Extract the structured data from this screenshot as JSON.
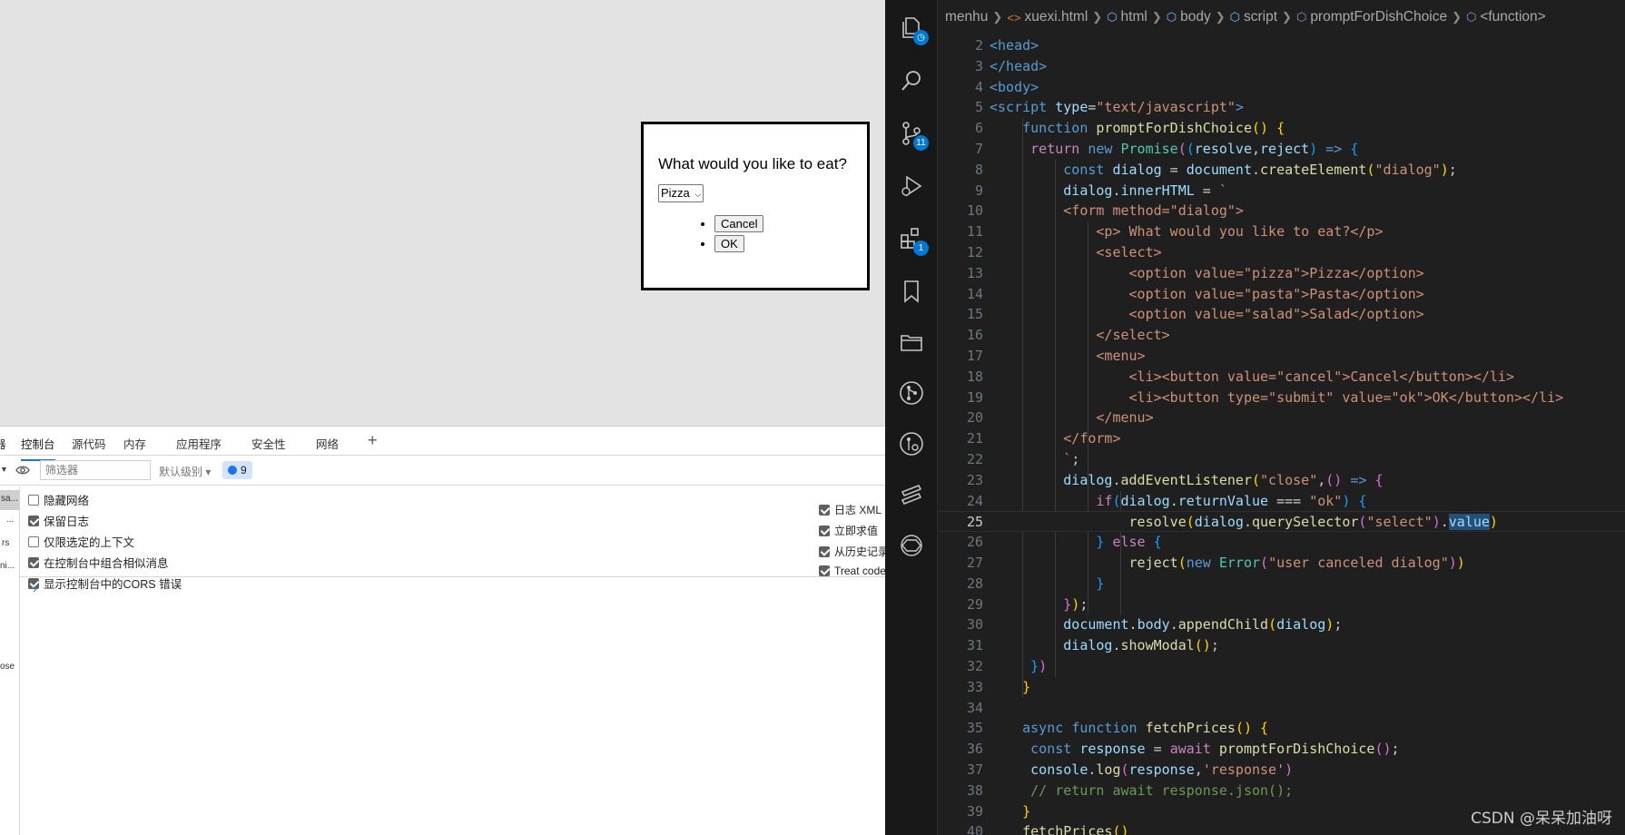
{
  "browser": {
    "dialog": {
      "question": "What would you like to eat?",
      "select_value": "Pizza",
      "cancel_label": "Cancel",
      "ok_label": "OK"
    }
  },
  "devtools": {
    "tabs": [
      "器",
      "控制台",
      "源代码",
      "内存",
      "应用程序",
      "安全性",
      "网络",
      "+"
    ],
    "active_tab": "控制台",
    "filter_placeholder": "筛选器",
    "level_label": "默认级别 ▾",
    "message_count": "9",
    "left_strip": [
      "sa...",
      "...",
      "rs",
      "ni...",
      "ose"
    ],
    "settings_left": [
      {
        "label": "隐藏网络",
        "checked": false
      },
      {
        "label": "保留日志",
        "checked": true
      },
      {
        "label": "仅限选定的上下文",
        "checked": false
      },
      {
        "label": "在控制台中组合相似消息",
        "checked": true
      },
      {
        "label": "显示控制台中的CORS 错误",
        "checked": true
      }
    ],
    "settings_right": [
      {
        "label": "日志 XML",
        "checked": true
      },
      {
        "label": "立即求值",
        "checked": true
      },
      {
        "label": "从历史记录",
        "checked": true
      },
      {
        "label": "Treat code",
        "checked": true
      }
    ],
    "prompt": "›"
  },
  "vscode": {
    "activity_badges": {
      "source_control": "11",
      "extensions": "1"
    },
    "breadcrumb": [
      "menhu",
      "xuexi.html",
      "html",
      "body",
      "script",
      "promptForDishChoice",
      "<function>"
    ],
    "current_line": 25,
    "lines": [
      {
        "n": "2",
        "html": "<span class='tk-tag'>&lt;head&gt;</span>"
      },
      {
        "n": "3",
        "html": "<span class='tk-tag'>&lt;/head&gt;</span>"
      },
      {
        "n": "4",
        "html": "<span class='tk-tag'>&lt;body&gt;</span>"
      },
      {
        "n": "5",
        "html": "<span class='tk-tag'>&lt;script</span> <span class='tk-attr'>type</span>=<span class='tk-str'>\"text/javascript\"</span><span class='tk-tag'>&gt;</span>"
      },
      {
        "n": "6",
        "html": "    <span class='tk-kw'>function</span> <span class='tk-fn'>promptForDishChoice</span><span class='tk-b1'>()</span> <span class='tk-b1'>{</span>"
      },
      {
        "n": "7",
        "html": "     <span class='tk-ctl'>return</span> <span class='tk-kw'>new</span> <span class='tk-cls'>Promise</span><span class='tk-b2'>(</span><span class='tk-b3'>(</span><span class='tk-var'>resolve</span>,<span class='tk-var'>reject</span><span class='tk-b3'>)</span> <span class='tk-kw'>=&gt;</span> <span class='tk-b3'>{</span>"
      },
      {
        "n": "8",
        "html": "         <span class='tk-kw'>const</span> <span class='tk-var'>dialog</span> = <span class='tk-var'>document</span>.<span class='tk-fn'>createElement</span><span class='tk-b1'>(</span><span class='tk-str'>\"dialog\"</span><span class='tk-b1'>)</span>;"
      },
      {
        "n": "9",
        "html": "         <span class='tk-var'>dialog</span>.<span class='tk-var'>innerHTML</span> = <span class='tk-str'>`</span>"
      },
      {
        "n": "10",
        "html": "         <span class='tk-str'>&lt;form method=\"dialog\"&gt;</span>"
      },
      {
        "n": "11",
        "html": "             <span class='tk-str'>&lt;p&gt; What would you like to eat?&lt;/p&gt;</span>"
      },
      {
        "n": "12",
        "html": "             <span class='tk-str'>&lt;select&gt;</span>"
      },
      {
        "n": "13",
        "html": "                 <span class='tk-str'>&lt;option value=\"pizza\"&gt;Pizza&lt;/option&gt;</span>"
      },
      {
        "n": "14",
        "html": "                 <span class='tk-str'>&lt;option value=\"pasta\"&gt;Pasta&lt;/option&gt;</span>"
      },
      {
        "n": "15",
        "html": "                 <span class='tk-str'>&lt;option value=\"salad\"&gt;Salad&lt;/option&gt;</span>"
      },
      {
        "n": "16",
        "html": "             <span class='tk-str'>&lt;/select&gt;</span>"
      },
      {
        "n": "17",
        "html": "             <span class='tk-str'>&lt;menu&gt;</span>"
      },
      {
        "n": "18",
        "html": "                 <span class='tk-str'>&lt;li&gt;&lt;button value=\"cancel\"&gt;Cancel&lt;/button&gt;&lt;/li&gt;</span>"
      },
      {
        "n": "19",
        "html": "                 <span class='tk-str'>&lt;li&gt;&lt;button type=\"submit\" value=\"ok\"&gt;OK&lt;/button&gt;&lt;/li&gt;</span>"
      },
      {
        "n": "20",
        "html": "             <span class='tk-str'>&lt;/menu&gt;</span>"
      },
      {
        "n": "21",
        "html": "         <span class='tk-str'>&lt;/form&gt;</span>"
      },
      {
        "n": "22",
        "html": "         <span class='tk-str'>`</span>;"
      },
      {
        "n": "23",
        "html": "         <span class='tk-var'>dialog</span>.<span class='tk-fn'>addEventListener</span><span class='tk-b1'>(</span><span class='tk-str'>\"close\"</span>,<span class='tk-b2'>()</span> <span class='tk-kw'>=&gt;</span> <span class='tk-b2'>{</span>"
      },
      {
        "n": "24",
        "html": "             <span class='tk-ctl'>if</span><span class='tk-b3'>(</span><span class='tk-var'>dialog</span>.<span class='tk-var'>returnValue</span> === <span class='tk-str'>\"ok\"</span><span class='tk-b3'>)</span> <span class='tk-b3'>{</span>"
      },
      {
        "n": "25",
        "html": "                 <span class='tk-fn'>resolve</span><span class='tk-b1'>(</span><span class='tk-var'>dialog</span>.<span class='tk-fn'>querySelector</span><span class='tk-b2'>(</span><span class='tk-str'>\"select\"</span><span class='tk-b2'>)</span>.<span class='tk-var hl-word'>value</span><span class='tk-b1'>)</span>"
      },
      {
        "n": "26",
        "html": "             <span class='tk-b3'>}</span> <span class='tk-ctl'>else</span> <span class='tk-b3'>{</span>"
      },
      {
        "n": "27",
        "html": "                 <span class='tk-fn'>reject</span><span class='tk-b1'>(</span><span class='tk-kw'>new</span> <span class='tk-cls'>Error</span><span class='tk-b2'>(</span><span class='tk-str'>\"user canceled dialog\"</span><span class='tk-b2'>)</span><span class='tk-b1'>)</span>"
      },
      {
        "n": "28",
        "html": "             <span class='tk-b3'>}</span>"
      },
      {
        "n": "29",
        "html": "         <span class='tk-b2'>}</span><span class='tk-b1'>)</span>;"
      },
      {
        "n": "30",
        "html": "         <span class='tk-var'>document</span>.<span class='tk-var'>body</span>.<span class='tk-fn'>appendChild</span><span class='tk-b1'>(</span><span class='tk-var'>dialog</span><span class='tk-b1'>)</span>;"
      },
      {
        "n": "31",
        "html": "         <span class='tk-var'>dialog</span>.<span class='tk-fn'>showModal</span><span class='tk-b1'>()</span>;"
      },
      {
        "n": "32",
        "html": "     <span class='tk-b3'>}</span><span class='tk-b2'>)</span>"
      },
      {
        "n": "33",
        "html": "    <span class='tk-b1'>}</span>"
      },
      {
        "n": "34",
        "html": ""
      },
      {
        "n": "35",
        "html": "    <span class='tk-kw'>async</span> <span class='tk-kw'>function</span> <span class='tk-fn'>fetchPrices</span><span class='tk-b1'>()</span> <span class='tk-b1'>{</span>"
      },
      {
        "n": "36",
        "html": "     <span class='tk-kw'>const</span> <span class='tk-var'>response</span> = <span class='tk-ctl'>await</span> <span class='tk-fn'>promptForDishChoice</span><span class='tk-b2'>()</span>;"
      },
      {
        "n": "37",
        "html": "     <span class='tk-var'>console</span>.<span class='tk-fn'>log</span><span class='tk-b2'>(</span><span class='tk-var'>response</span>,<span class='tk-str'>'response'</span><span class='tk-b2'>)</span>"
      },
      {
        "n": "38",
        "html": "     <span class='tk-com'>// return await response.json();</span>"
      },
      {
        "n": "39",
        "html": "    <span class='tk-b1'>}</span>"
      },
      {
        "n": "40",
        "html": "    <span class='tk-fn'>fetchPrices</span><span class='tk-b1'>()</span>"
      }
    ]
  },
  "watermark": "CSDN @呆呆加油呀"
}
